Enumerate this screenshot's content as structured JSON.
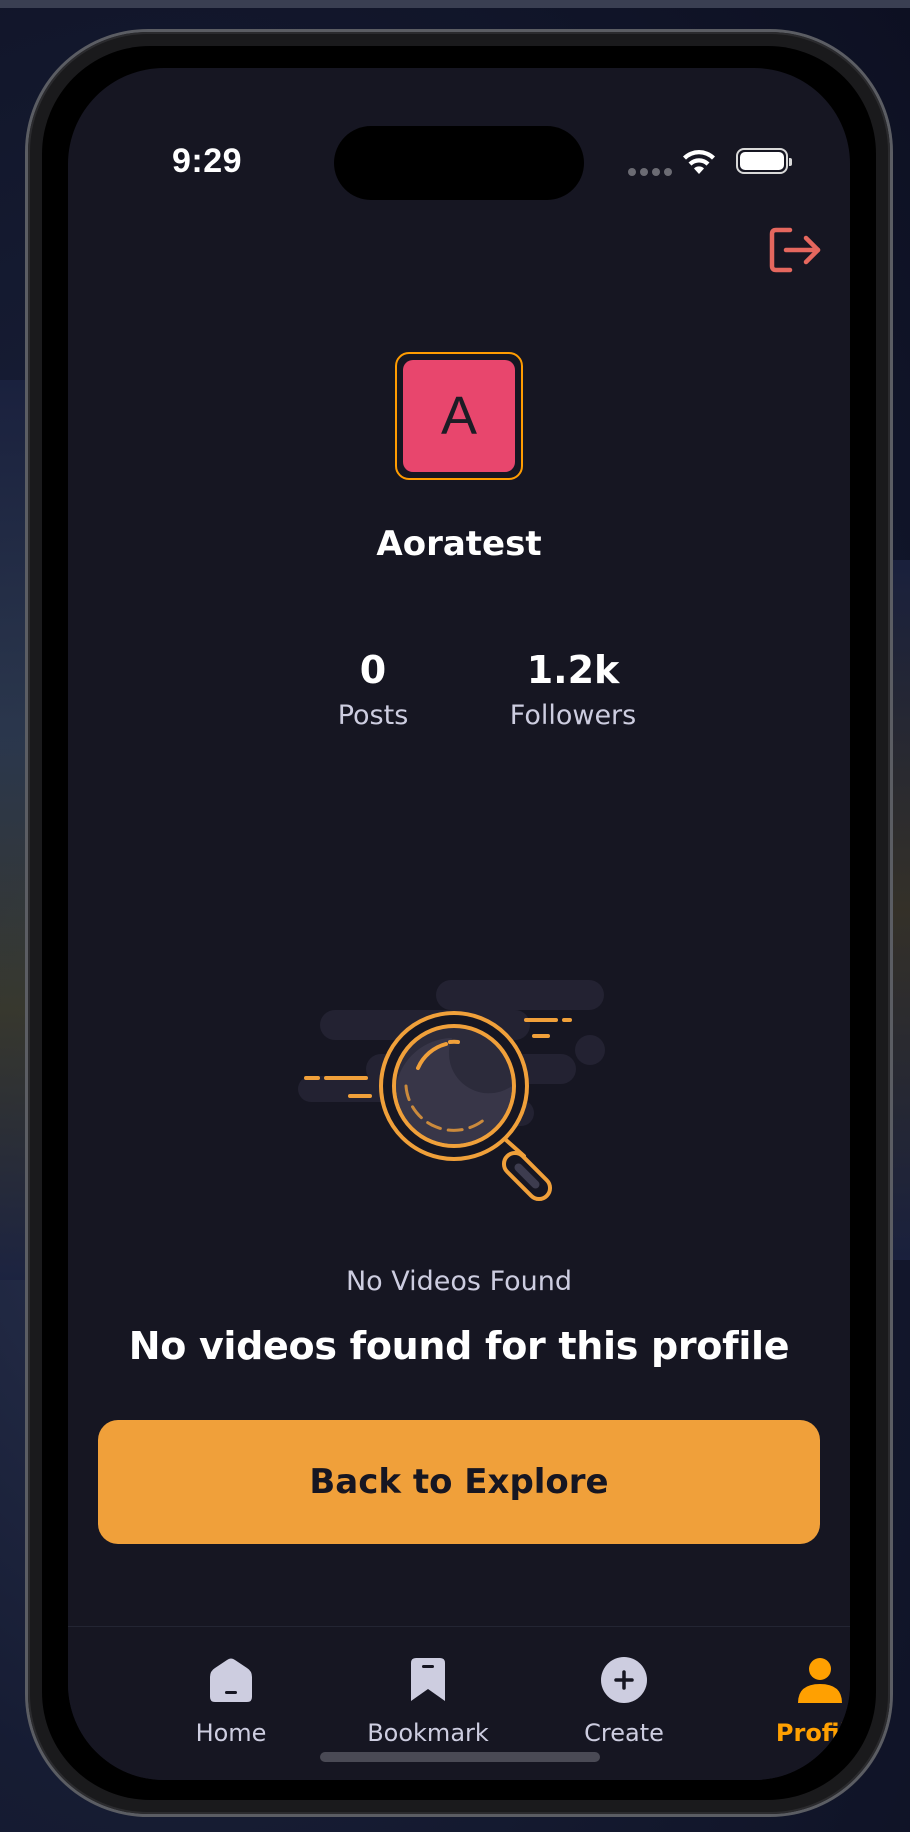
{
  "status_bar": {
    "time": "9:29"
  },
  "header": {
    "logout_icon": "logout-icon",
    "logout_color": "#e5675e"
  },
  "profile": {
    "avatar_initial": "A",
    "avatar_color": "#e8466d",
    "avatar_border_color": "#ff9c01",
    "username": "Aoratest",
    "stats": [
      {
        "value": "0",
        "label": "Posts"
      },
      {
        "value": "1.2k",
        "label": "Followers"
      }
    ]
  },
  "empty_state": {
    "illustration_icon": "magnifier-search-icon",
    "title": "No Videos Found",
    "subtitle": "No videos found for this profile",
    "button_label": "Back to Explore",
    "button_color": "#f0a03a"
  },
  "tabbar": {
    "items": [
      {
        "label": "Home",
        "icon": "home-icon",
        "active": false
      },
      {
        "label": "Bookmark",
        "icon": "bookmark-icon",
        "active": false
      },
      {
        "label": "Create",
        "icon": "plus-icon",
        "active": false
      },
      {
        "label": "Profile",
        "icon": "profile-icon",
        "active": true
      }
    ],
    "active_color": "#ffa001",
    "inactive_color": "#cdcde0"
  },
  "colors": {
    "background": "#161622",
    "accent": "#ffa001"
  }
}
